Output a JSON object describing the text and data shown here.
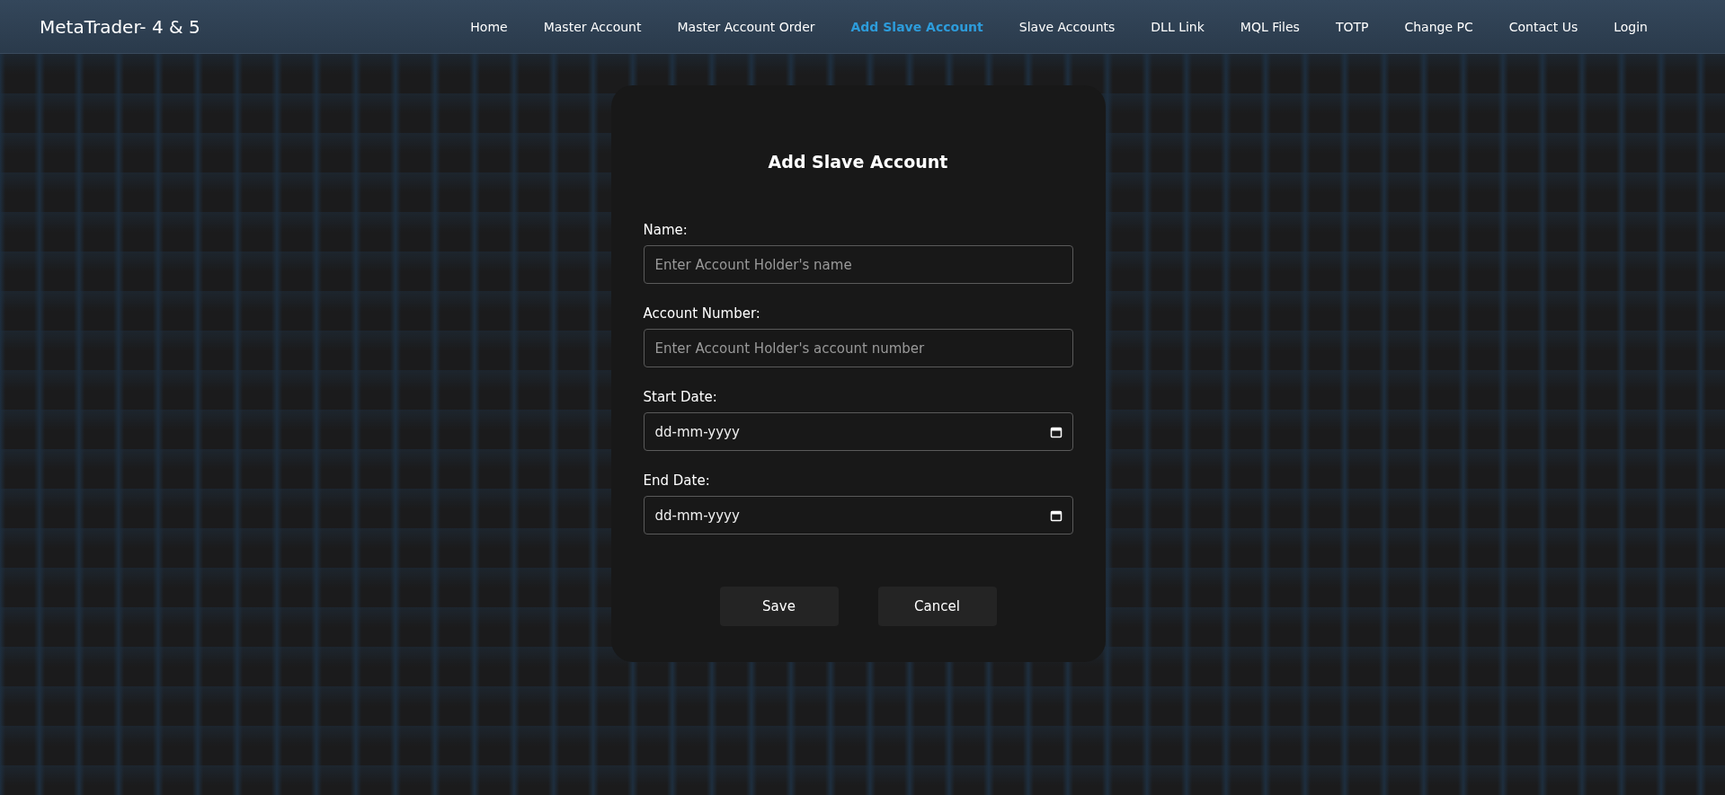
{
  "brand": "MetaTrader- 4 & 5",
  "nav": [
    {
      "label": "Home",
      "selected": false
    },
    {
      "label": "Master Account",
      "selected": false
    },
    {
      "label": "Master Account Order",
      "selected": false
    },
    {
      "label": "Add Slave Account",
      "selected": true
    },
    {
      "label": "Slave Accounts",
      "selected": false
    },
    {
      "label": "DLL Link",
      "selected": false
    },
    {
      "label": "MQL Files",
      "selected": false
    },
    {
      "label": "TOTP",
      "selected": false
    },
    {
      "label": "Change PC",
      "selected": false
    },
    {
      "label": "Contact Us",
      "selected": false
    },
    {
      "label": "Login",
      "selected": false
    }
  ],
  "form": {
    "title": "Add Slave Account",
    "fields": [
      {
        "kind": "text",
        "label": "Name:",
        "placeholder": "Enter Account Holder's name"
      },
      {
        "kind": "text",
        "label": "Account Number:",
        "placeholder": "Enter Account Holder's account number"
      },
      {
        "kind": "date",
        "label": "Start Date:",
        "placeholder": "dd-mm-yyyy"
      },
      {
        "kind": "date",
        "label": "End Date:",
        "placeholder": "dd-mm-yyyy"
      }
    ],
    "buttons": [
      "Save",
      "Cancel"
    ]
  }
}
